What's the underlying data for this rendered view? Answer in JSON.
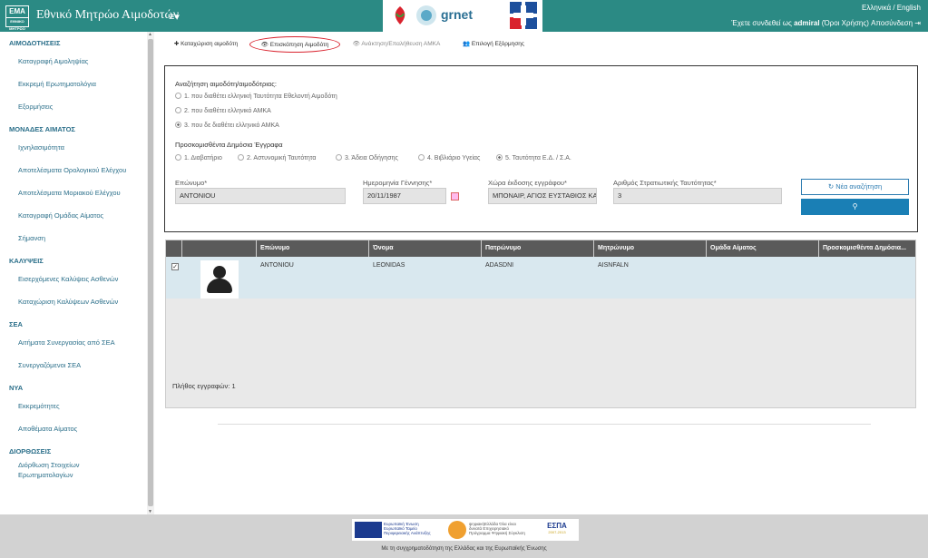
{
  "header": {
    "logo_text": "EMA",
    "logo_sub": "ΕΘΝΙΚΟ ΜΗΤΡΩΟ ΑΙΜΟΔΟΤΩΝ",
    "title": "Εθνικό Μητρώο Αιμοδοτών",
    "menu_toggle": "≡▾",
    "partner_logos": [
      "eoda-logo",
      "grnet-logo",
      "cross-logo"
    ],
    "grnet_label": "grnet",
    "language": "Ελληνικά / English",
    "logged_prefix": "Έχετε συνδεθεί ως",
    "username": "admiral",
    "terms": "(Όροι Χρήσης)",
    "logout": "Αποσύνδεση"
  },
  "sidebar": [
    {
      "section": "ΑΙΜΟΔΟΤΗΣΕΙΣ",
      "items": [
        "Καταγραφή Αιμοληψίας",
        "Εκκρεμή Ερωτηματολόγια",
        "Εξορμήσεις"
      ]
    },
    {
      "section": "ΜΟΝΑΔΕΣ ΑΙΜΑΤΟΣ",
      "items": [
        "Ιχνηλασιμότητα",
        "Αποτελέσματα Ορολογικού Ελέγχου",
        "Αποτελέσματα Μοριακού Ελέγχου",
        "Καταγραφή Ομάδας Αίματος",
        "Σήμανση"
      ]
    },
    {
      "section": "ΚΑΛΥΨΕΙΣ",
      "items": [
        "Εισερχόμενες Καλύψεις Ασθενών",
        "Καταχώριση Καλύψεων Ασθενών"
      ]
    },
    {
      "section": "ΣΕΑ",
      "items": [
        "Αιτήματα Συνεργασίας από ΣΕΑ",
        "Συνεργαζόμενοι ΣΕΑ"
      ]
    },
    {
      "section": "ΝΥΑ",
      "items": [
        "Εκκρεμότητες",
        "Αποθέματα Αίματος"
      ]
    },
    {
      "section": "ΔΙΟΡΘΩΣΕΙΣ",
      "items": [
        "Διόρθωση Στοιχείων Ερωτηματολογίων"
      ]
    }
  ],
  "tabs": {
    "register": "✚ Καταχώριση αιμοδότη",
    "overview": "👁 Επισκόπηση Αιμοδότη",
    "amka": "👁 Ανάκτηση/Επαλήθευση ΑΜΚΑ",
    "campaign": "👥 Επιλογή Εξόρμησης"
  },
  "search": {
    "label": "Αναζήτηση αιμοδότη/αιμοδότριας:",
    "options": [
      {
        "label": "1. που διαθέτει ελληνική Ταυτότητα Εθελοντή Αιμοδότη",
        "selected": false
      },
      {
        "label": "2. που διαθέτει ελληνικό ΑΜΚΑ",
        "selected": false
      },
      {
        "label": "3. που δε διαθέτει ελληνικό ΑΜΚΑ",
        "selected": true
      }
    ],
    "docs_label": "Προσκομισθέντα Δημόσια Έγγραφα",
    "docs": [
      {
        "label": "1. Διαβατήριο",
        "selected": false
      },
      {
        "label": "2. Αστυνομική Ταυτότητα",
        "selected": false
      },
      {
        "label": "3. Άδεια Οδήγησης",
        "selected": false
      },
      {
        "label": "4. Βιβλιάριο Υγείας",
        "selected": false
      },
      {
        "label": "5. Ταυτότητα Ε.Δ. / Σ.Α.",
        "selected": true
      }
    ],
    "fields": {
      "surname_label": "Επώνυμο*",
      "surname_value": "ANTONIOU",
      "dob_label": "Ημερομηνία Γέννησης*",
      "dob_value": "20/11/1987",
      "country_label": "Χώρα έκδοσης εγγράφου*",
      "country_value": "ΜΠΟΝΑΙΡ, ΑΓΙΟΣ ΕΥΣΤΑΘΙΟΣ ΚΑ",
      "military_label": "Αριθμός Στρατιωτικής Ταυτότητας*",
      "military_value": "3"
    },
    "new_search": "↻ Νέα αναζήτηση",
    "search_icon": "🔍"
  },
  "results": {
    "columns": [
      "Επώνυμο",
      "Όνομα",
      "Πατρώνυμο",
      "Μητρώνυμο",
      "Ομάδα Αίματος",
      "Προσκομισθέντα Δημόσια..."
    ],
    "rows": [
      {
        "checked": "✓",
        "surname": "ANTONIOU",
        "name": "LEONIDAS",
        "father": "ADASDNI",
        "mother": "AISNFALN",
        "blood": "",
        "docs": ""
      }
    ],
    "count": "Πλήθος εγγραφών: 1"
  },
  "footer": {
    "eu_text": "Ευρωπαϊκή Ένωση Ευρωπαϊκό Ταμείο Περιφερειακής Ανάπτυξης",
    "digital_text": "ψηφιακήΕλλάδα Όλα είναι δυνατά Επιχειρησιακό Πρόγραμμα Ψηφιακή Σύγκλιση",
    "espa": "ΕΣΠΑ",
    "espa_years": "2007-2013",
    "cofunded": "Με τη συγχρηματοδότηση της Ελλάδας και της Ευρωπαϊκής Ένωσης"
  },
  "colors": {
    "header": "#2b8a84",
    "link": "#2b6f8a",
    "primary": "#1a7fb5",
    "highlight": "#d9232e"
  }
}
